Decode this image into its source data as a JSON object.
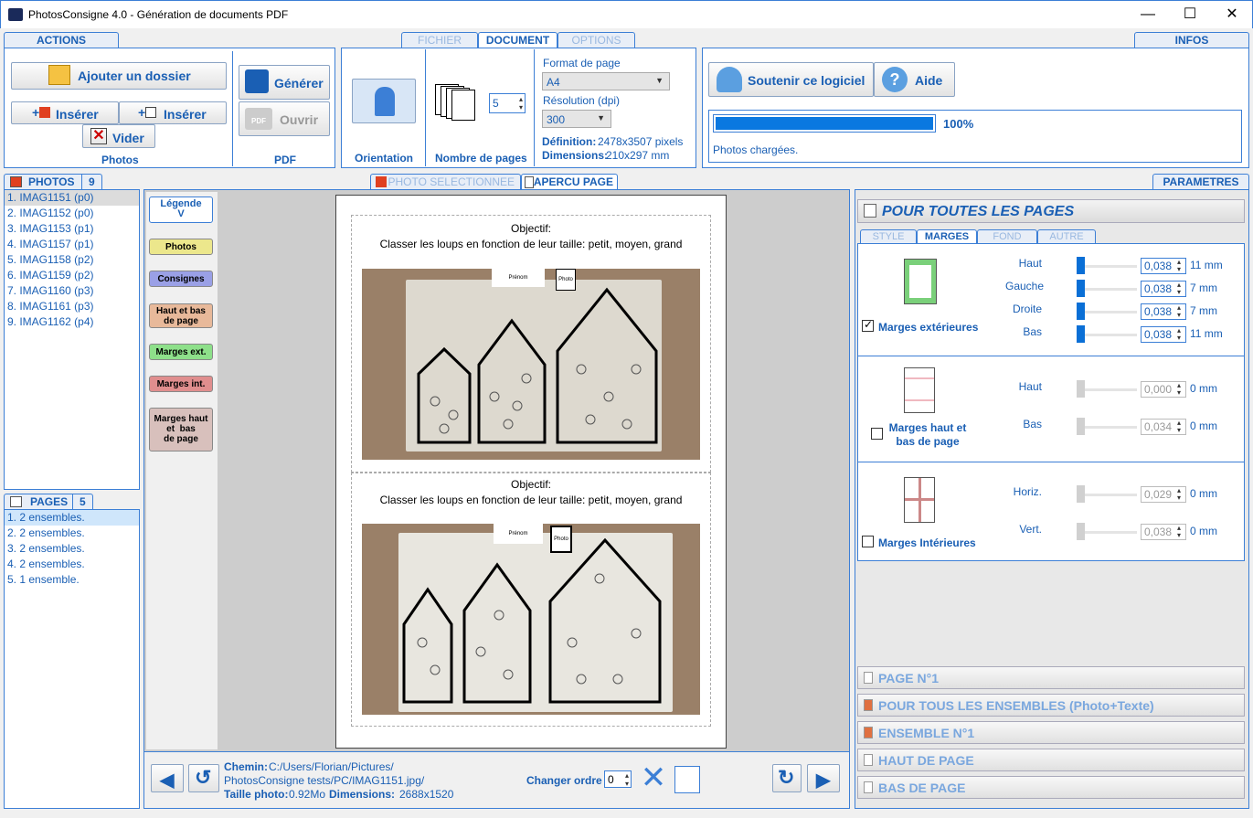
{
  "window": {
    "title": "PhotosConsigne 4.0 - Génération de documents PDF",
    "min": "—",
    "max": "☐",
    "close": "✕"
  },
  "actions": {
    "tab": "ACTIONS",
    "add_folder": "Ajouter un dossier",
    "insert1": "Insérer",
    "insert2": "Insérer",
    "clear": "Vider",
    "photos_label": "Photos",
    "generate": "Générer",
    "open": "Ouvrir",
    "pdf_label": "PDF"
  },
  "doc_tabs": {
    "file": "FICHIER",
    "document": "DOCUMENT",
    "options": "OPTIONS"
  },
  "document": {
    "orientation": "Orientation",
    "pages_label": "Nombre de pages",
    "pages_value": "5",
    "format_label": "Format de page",
    "format_value": "A4",
    "resolution_label": "Résolution (dpi)",
    "resolution_value": "300",
    "definition_label": "Définition:",
    "definition_value": "2478x3507 pixels",
    "dimensions_label": "Dimensions:",
    "dimensions_value": "210x297 mm"
  },
  "infos": {
    "tab": "INFOS",
    "support": "Soutenir ce logiciel",
    "help": "Aide",
    "progress": 1.0,
    "progress_text": "100%",
    "status": "Photos chargées."
  },
  "photos": {
    "tab": "PHOTOS",
    "count": "9",
    "items": [
      "1. IMAG1151 (p0)",
      "2. IMAG1152 (p0)",
      "3. IMAG1153 (p1)",
      "4. IMAG1157 (p1)",
      "5. IMAG1158 (p2)",
      "6. IMAG1159 (p2)",
      "7. IMAG1160 (p3)",
      "8. IMAG1161 (p3)",
      "9. IMAG1162 (p4)"
    ]
  },
  "pages": {
    "tab": "PAGES",
    "count": "5",
    "items": [
      "1. 2 ensembles.",
      "2. 2 ensembles.",
      "3. 2 ensembles.",
      "4. 2 ensembles.",
      "5. 1 ensemble."
    ]
  },
  "center_tabs": {
    "selected": "PHOTO SELECTIONNEE",
    "preview": "APERCU PAGE"
  },
  "legend": {
    "legend": "Légende\nV",
    "photos": "Photos",
    "consignes": "Consignes",
    "hb": "Haut et bas\nde page",
    "ext": "Marges ext.",
    "int": "Marges int.",
    "mhb": "Marges haut\net  bas\nde page"
  },
  "preview": {
    "obj1": "Objectif:",
    "txt1": "Classer les loups en fonction de leur taille: petit, moyen, grand",
    "obj2": "Objectif:",
    "txt2": "Classer les loups en fonction de leur taille: petit, moyen, grand",
    "card_prenom": "Prénom",
    "card_photo": "Photo"
  },
  "footer": {
    "path_label": "Chemin:",
    "path1": "C:/Users/Florian/Pictures/",
    "path2": "PhotosConsigne tests/PC/IMAG1151.jpg/",
    "size_label": "Taille photo:",
    "size_value": "0.92Mo",
    "dim_label": "Dimensions:",
    "dim_value": "2688x1520",
    "order_label": "Changer ordre",
    "order_value": "0"
  },
  "params": {
    "tab": "PARAMETRES",
    "all_pages": "POUR TOUTES LES PAGES",
    "subtabs": [
      "STYLE",
      "MARGES",
      "FOND",
      "AUTRE"
    ],
    "ext": {
      "label": "Marges extérieures",
      "rows": [
        {
          "l": "Haut",
          "v": "0,038",
          "mm": "11 mm"
        },
        {
          "l": "Gauche",
          "v": "0,038",
          "mm": "7 mm"
        },
        {
          "l": "Droite",
          "v": "0,038",
          "mm": "7 mm"
        },
        {
          "l": "Bas",
          "v": "0,038",
          "mm": "11 mm"
        }
      ]
    },
    "hb": {
      "label": "Marges haut et bas de page",
      "rows": [
        {
          "l": "Haut",
          "v": "0,000",
          "mm": "0 mm"
        },
        {
          "l": "Bas",
          "v": "0,034",
          "mm": "0 mm"
        }
      ]
    },
    "int": {
      "label": "Marges Intérieures",
      "rows": [
        {
          "l": "Horiz.",
          "v": "0,029",
          "mm": "0 mm"
        },
        {
          "l": "Vert.",
          "v": "0,038",
          "mm": "0 mm"
        }
      ]
    },
    "sections": [
      "PAGE N°1",
      "POUR TOUS LES ENSEMBLES (Photo+Texte)",
      "ENSEMBLE N°1",
      "HAUT DE PAGE",
      "BAS DE PAGE"
    ]
  }
}
